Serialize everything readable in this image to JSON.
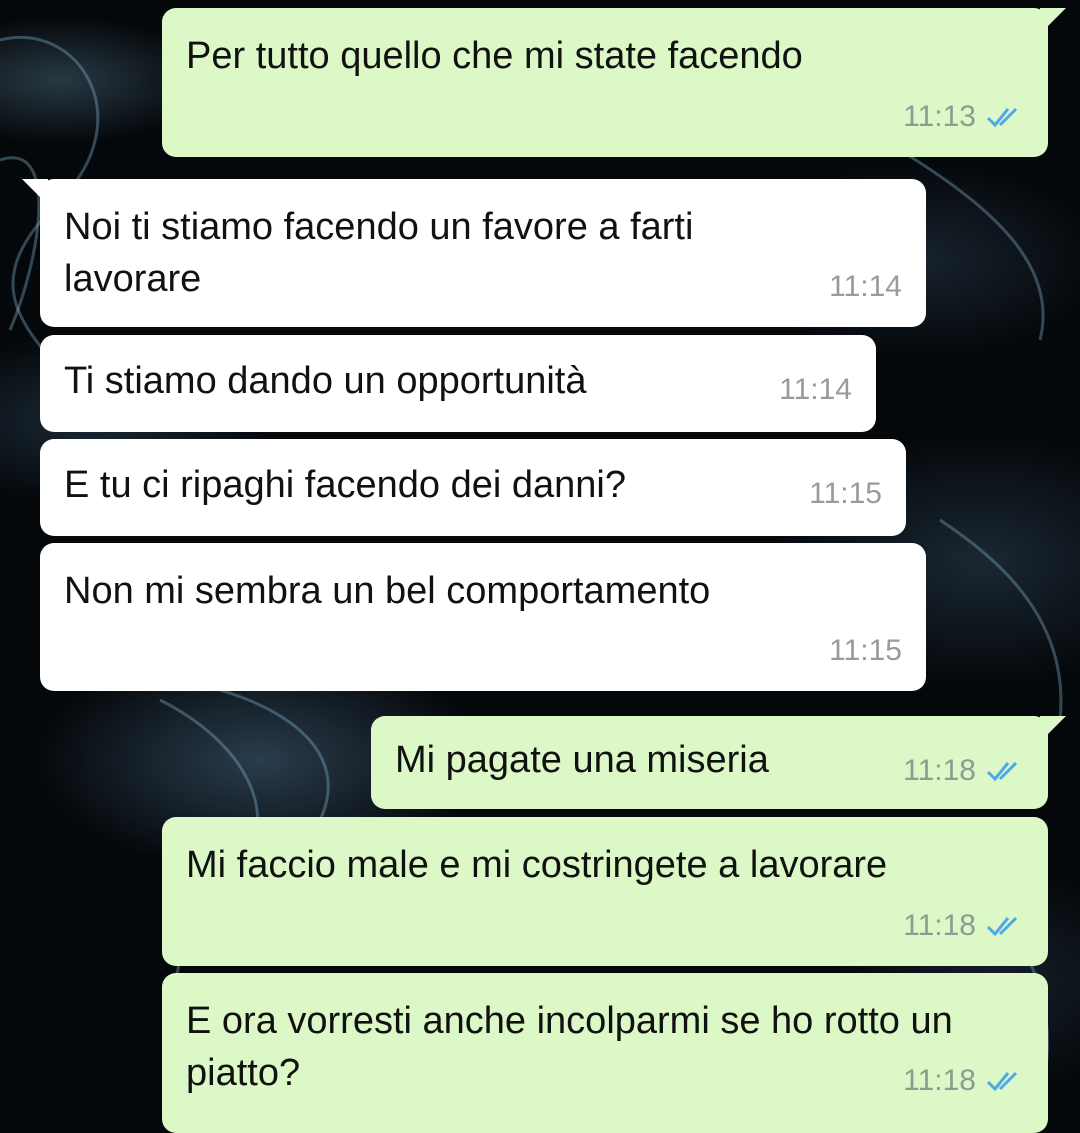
{
  "messages": [
    {
      "dir": "out",
      "text": "Per tutto quello che mi state facendo",
      "time": "11:13",
      "read": true
    },
    {
      "dir": "in",
      "text": "Noi ti stiamo facendo un favore a farti lavorare",
      "time": "11:14"
    },
    {
      "dir": "in",
      "text": "Ti stiamo dando un opportunità",
      "time": "11:14"
    },
    {
      "dir": "in",
      "text": "E tu ci ripaghi facendo dei danni?",
      "time": "11:15"
    },
    {
      "dir": "in",
      "text": "Non mi sembra un bel comportamento",
      "time": "11:15"
    },
    {
      "dir": "out",
      "text": "Mi pagate una miseria",
      "time": "11:18",
      "read": true
    },
    {
      "dir": "out",
      "text": "Mi faccio male e mi costringete a lavorare",
      "time": "11:18",
      "read": true
    },
    {
      "dir": "out",
      "text": "E ora vorresti anche incolparmi se ho rotto un piatto?",
      "time": "11:18",
      "read": true
    }
  ],
  "colors": {
    "incoming": "#ffffff",
    "outgoing": "#dcf8c6",
    "read_ticks": "#4fa8e8",
    "background": "#05080b"
  },
  "icons": {
    "read_receipt": "double-check-icon"
  }
}
